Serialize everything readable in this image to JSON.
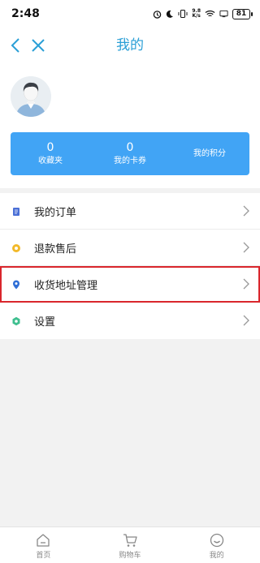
{
  "status_bar": {
    "time": "2:48",
    "net_speed_value": "9.8",
    "net_speed_unit": "K/s",
    "battery": "81"
  },
  "nav": {
    "title": "我的"
  },
  "stats": [
    {
      "value": "0",
      "label": "收藏夹"
    },
    {
      "value": "0",
      "label": "我的卡券"
    },
    {
      "value": "",
      "label": "我的积分"
    }
  ],
  "menu": [
    {
      "label": "我的订单",
      "icon": "order-icon",
      "color": "#4a6fd6"
    },
    {
      "label": "退款售后",
      "icon": "refund-icon",
      "color": "#f2b92a"
    },
    {
      "label": "收货地址管理",
      "icon": "location-pin-icon",
      "color": "#2f6fd6"
    },
    {
      "label": "设置",
      "icon": "settings-icon",
      "color": "#3fbf8f"
    }
  ],
  "tabs": [
    {
      "label": "首页",
      "icon": "home-icon"
    },
    {
      "label": "购物车",
      "icon": "cart-icon"
    },
    {
      "label": "我的",
      "icon": "profile-smile-icon"
    }
  ],
  "colors": {
    "accent": "#2a9fd6",
    "card": "#41a4f5",
    "highlight_border": "#d9262c"
  }
}
